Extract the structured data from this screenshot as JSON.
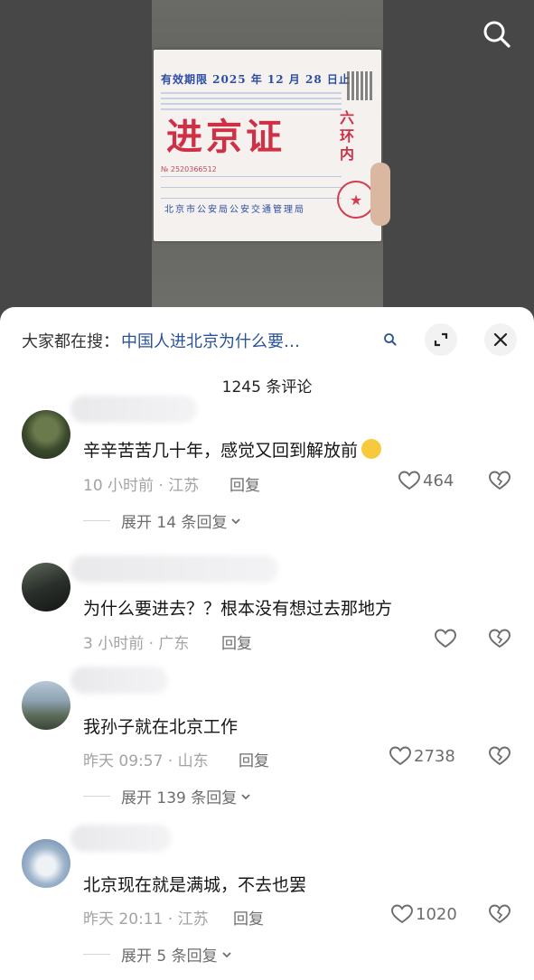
{
  "video": {
    "permit": {
      "validity": "有效期限 2025 年 12 月 28 日止",
      "title": "进京证",
      "zone": "六环内",
      "number": "№ 2520366512",
      "issuer": "北京市公安局公安交通管理局"
    },
    "icons": {
      "search": "search-icon"
    }
  },
  "sheet": {
    "search_prefix": "大家都在搜：",
    "search_query": "中国人进北京为什么要…",
    "comment_count": "1245 条评论",
    "icons": {
      "expand": "expand-icon",
      "close": "close-icon"
    }
  },
  "comments": [
    {
      "text": "辛辛苦苦几十年，感觉又回到解放前",
      "emoji": "laughing-crying-emoji",
      "time": "10 小时前 · 江苏",
      "reply": "回复",
      "likes": "464",
      "expand": "展开 14 条回复"
    },
    {
      "text": "为什么要进去？？根本没有想过去那地方",
      "time": "3 小时前 · 广东",
      "reply": "回复",
      "likes": "",
      "expand": ""
    },
    {
      "text": "我孙子就在北京工作",
      "time": "昨天 09:57 · 山东",
      "reply": "回复",
      "likes": "2738",
      "expand": "展开 139 条回复"
    },
    {
      "text": "北京现在就是满城，不去也罢",
      "time": "昨天 20:11 · 江苏",
      "reply": "回复",
      "likes": "1020",
      "expand": "展开 5 条回复"
    }
  ],
  "colors": {
    "link": "#2a5298",
    "text": "#161616",
    "meta": "#a3a3a3",
    "sheet": "#ffffff"
  }
}
